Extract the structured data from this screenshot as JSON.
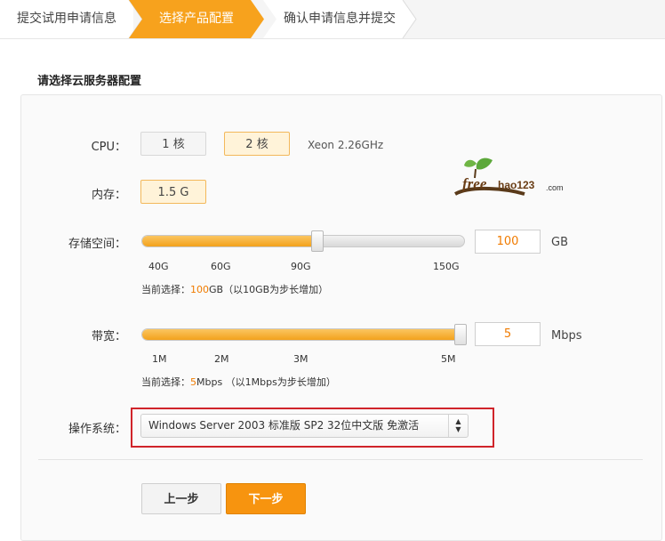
{
  "steps": [
    {
      "label": "提交试用申请信息",
      "state": "done"
    },
    {
      "label": "选择产品配置",
      "state": "active"
    },
    {
      "label": "确认申请信息并提交",
      "state": "pending"
    }
  ],
  "section": {
    "title": "请选择云服务器配置"
  },
  "cpu": {
    "label": "CPU：",
    "options": [
      {
        "label": "1 核",
        "selected": false
      },
      {
        "label": "2 核",
        "selected": true
      }
    ],
    "info": "Xeon 2.26GHz"
  },
  "memory": {
    "label": "内存：",
    "options": [
      {
        "label": "1.5 G",
        "selected": true
      }
    ]
  },
  "storage": {
    "label": "存储空间：",
    "value": "100",
    "unit": "GB",
    "min": 40,
    "max": 150,
    "current": 100,
    "ticks": [
      "40G",
      "60G",
      "90G",
      "150G"
    ],
    "hint_prefix": "当前选择：",
    "hint_value": "100",
    "hint_suffix": "GB（以10GB为步长增加）"
  },
  "bandwidth": {
    "label": "带宽：",
    "value": "5",
    "unit": "Mbps",
    "min": 1,
    "max": 5,
    "current": 5,
    "ticks": [
      "1M",
      "2M",
      "3M",
      "5M"
    ],
    "hint_prefix": "当前选择：",
    "hint_value": "5",
    "hint_suffix": "Mbps （以1Mbps为步长增加）"
  },
  "os": {
    "label": "操作系统：",
    "selected": "Windows Server 2003 标准版 SP2 32位中文版 免激活"
  },
  "buttons": {
    "prev": "上一步",
    "next": "下一步"
  },
  "watermark": {
    "text": "freehao123",
    "tld": ".com"
  },
  "colors": {
    "accent": "#f7a21d",
    "value": "#f07b00",
    "highlight_border": "#d0242a"
  }
}
